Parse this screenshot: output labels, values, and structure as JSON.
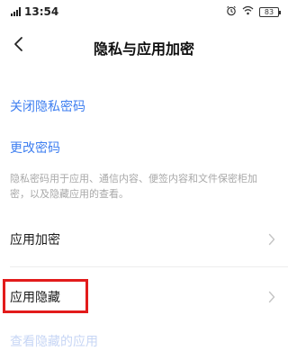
{
  "status_bar": {
    "time": "13:54",
    "battery": "83",
    "icons": [
      "signal-icon",
      "alarm-icon",
      "wifi-icon",
      "battery-icon"
    ]
  },
  "nav": {
    "back_icon": "chevron-left-icon",
    "title": "隐私与应用加密"
  },
  "links": {
    "disable_password": "关闭隐私密码",
    "change_password": "更改密码"
  },
  "description": "隐私密码用于应用、通信内容、便签内容和文件保密柜加密，以及隐藏应用的查看。",
  "rows": [
    {
      "label": "应用加密"
    },
    {
      "label": "应用隐藏"
    }
  ],
  "footer_link": "查看隐藏的应用",
  "colors": {
    "link": "#3f7ff0",
    "highlight": "#e21b1b",
    "secondary_text": "#a8a8a8"
  }
}
